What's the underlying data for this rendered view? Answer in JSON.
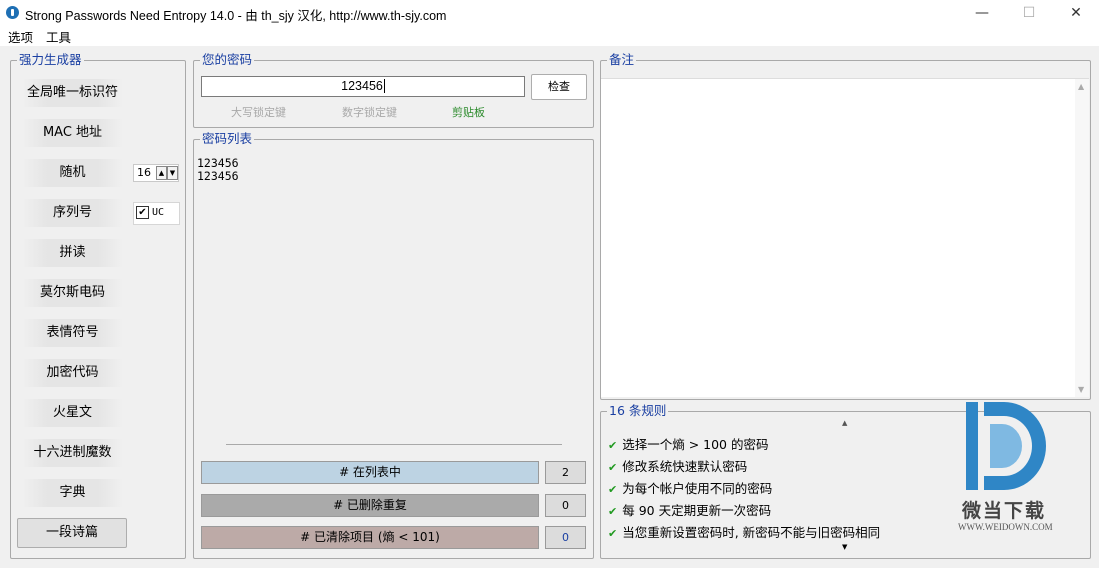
{
  "window": {
    "title": "Strong Passwords Need Entropy 14.0 - 由 th_sjy 汉化, http://www.th-sjy.com",
    "minimize": "—",
    "maximize": "☐",
    "close": "✕"
  },
  "menu": [
    "选项",
    "工具"
  ],
  "generator": {
    "title": "强力生成器",
    "buttons": [
      "全局唯一标识符",
      "MAC 地址",
      "随机",
      "序列号",
      "拼读",
      "莫尔斯电码",
      "表情符号",
      "加密代码",
      "火星文",
      "十六进制魔数",
      "字典",
      "一段诗篇"
    ],
    "random_length": "16",
    "uc_label": "UC",
    "uc_checked": true
  },
  "password": {
    "title": "您的密码",
    "value": "123456",
    "check_button": "检查",
    "caps_lock": "大写锁定键",
    "num_lock": "数字锁定键",
    "clipboard": "剪贴板"
  },
  "password_list": {
    "title": "密码列表",
    "items": [
      "123456",
      "123456"
    ],
    "stats": [
      {
        "label": "# 在列表中",
        "count": "2"
      },
      {
        "label": "# 已删除重复",
        "count": "0"
      },
      {
        "label": "# 已清除项目 (熵 < 101)",
        "count": "0"
      }
    ]
  },
  "notes": {
    "title": "备注"
  },
  "rules": {
    "title": "16 条规则",
    "items": [
      "选择一个熵 > 100 的密码",
      "修改系统快速默认密码",
      "为每个帐户使用不同的密码",
      "每 90 天定期更新一次密码",
      "当您重新设置密码时, 新密码不能与旧密码相同"
    ]
  },
  "watermark": {
    "brand": "微当下载",
    "url": "WWW.WEIDOWN.COM"
  },
  "colors": {
    "legend": "#1a3fa2",
    "clipboard": "#2a8a2a",
    "stat_in_list": "#bdd3e3",
    "stat_removed_dup": "#aaaaaa",
    "stat_cleared": "#bdaaa7",
    "tick": "#219a21",
    "watermark": "#2f86c6"
  }
}
